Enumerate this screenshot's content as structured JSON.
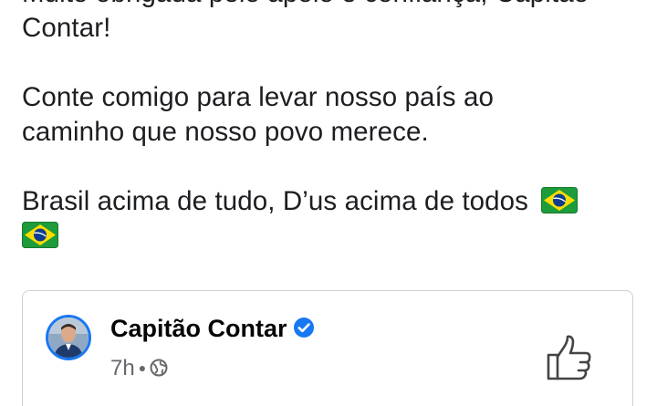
{
  "post": {
    "line1": "Muito obrigada pelo apoio e confiança, Capitão",
    "line2": "Contar!",
    "line3": "Conte comigo para levar nosso país ao",
    "line4": "caminho que nosso povo merece.",
    "line5": "Brasil acima de tudo, D’us acima de todos",
    "flag_icon": "brazil-flag-emoji"
  },
  "shared_post": {
    "page_name": "Capitão Contar",
    "verified": true,
    "time": "7h",
    "audience_icon": "globe-icon",
    "like_icon": "thumbs-up-icon"
  },
  "colors": {
    "text": "#1c1e21",
    "meta": "#65676b",
    "accent": "#1877f2",
    "border": "#ced0d4"
  }
}
